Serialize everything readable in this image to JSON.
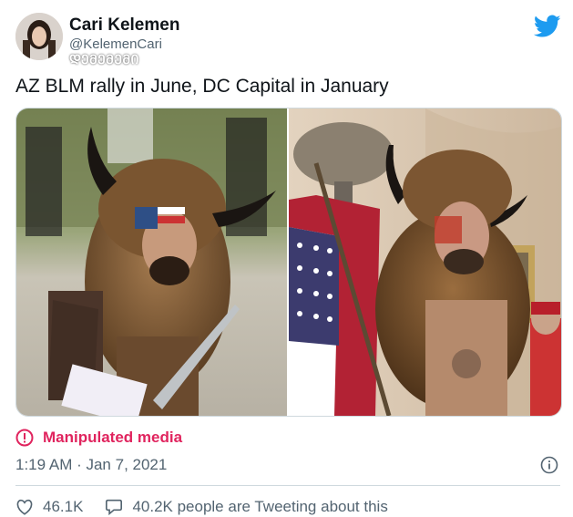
{
  "author": {
    "name": "Cari Kelemen",
    "handle": "@KelemenCari",
    "overlay_text": "ᲓᲔᲛᲔᲛᲔᲛᲘ"
  },
  "tweet": {
    "text": "AZ BLM rally in June, DC Capital in January"
  },
  "media": {
    "left_alt": "",
    "right_alt": ""
  },
  "label": {
    "text": "Manipulated media",
    "color": "#e0245e"
  },
  "meta": {
    "time": "1:19 AM · Jan 7, 2021"
  },
  "actions": {
    "likes": "46.1K",
    "tweeting": "40.2K people are Tweeting about this"
  },
  "colors": {
    "twitter_blue": "#1d9bf0",
    "secondary_text": "#536471"
  }
}
